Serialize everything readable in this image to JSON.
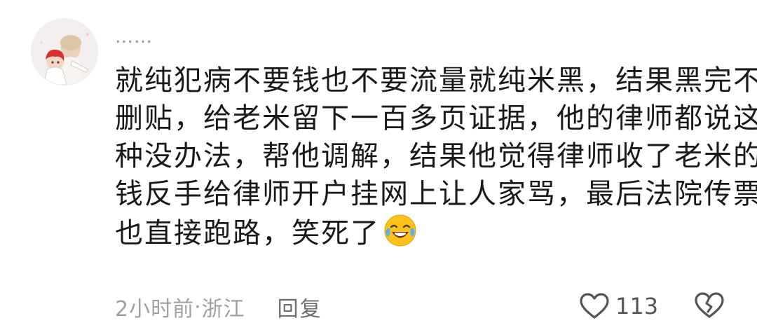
{
  "comment": {
    "username": "……",
    "text_lines": [
      "就纯犯病不要钱也不要流量就纯米黑，结果黑完不",
      "删贴，给老米留下一百多页证据，他的律师都说这",
      "种没办法，帮他调解，结果他觉得律师收了老米的",
      "钱反手给律师开户挂网上让人家骂，最后法院传票",
      "也直接跑路，笑死了"
    ],
    "emoji": "laughing-crying-emoji",
    "time": "2小时前",
    "separator": " · ",
    "location": "浙江",
    "reply_label": "回复",
    "like_count": "113"
  },
  "colors": {
    "text": "#1a1a1a",
    "meta": "#a0a0a0",
    "reply": "#6f6f6f",
    "icon": "#555555"
  },
  "icons": {
    "like": "heart-outline-icon",
    "dislike": "broken-heart-icon"
  }
}
